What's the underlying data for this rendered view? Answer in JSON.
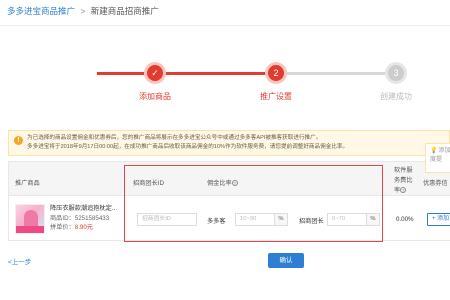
{
  "breadcrumb": {
    "root": "多多进宝商品推广",
    "separator": ">",
    "current": "新建商品招商推广"
  },
  "steps": [
    {
      "label": "添加商品",
      "state": "done",
      "icon": "check-icon"
    },
    {
      "label": "推广设置",
      "state": "active",
      "number": "2"
    },
    {
      "label": "创建成功",
      "state": "todo",
      "number": "3"
    }
  ],
  "notice": {
    "icon": "warning-icon",
    "line1": "为已选择的商品设置佣金和优惠券后，您的推广商品将展示在多多进宝公众号中或通过多多客API被推客获取进行推广。",
    "line2": "多多进宝将于2018年9月17日00:00起，在成功推广商品后收取该商品佣金的10%作为软件服务费，请您提前调整好商品佣金比率。"
  },
  "tooltip": {
    "icon": "lightbulb-icon",
    "line1": "添加",
    "line2": "度提"
  },
  "table": {
    "headers": {
      "product": "推广商品",
      "group_id": "招商团长ID",
      "rate": "佣金比率",
      "service_fee": "软件服务费比率",
      "coupon": "优惠券信"
    },
    "row": {
      "name": "降压衣服款潮追抱枕定...",
      "id_label": "商品ID：",
      "id": "5251585433",
      "price_label": "拼单价：",
      "price": "8.90元",
      "group_placeholder": "招商团长ID",
      "rate_label_1": "多多客",
      "rate_placeholder_1": "10~90",
      "pct": "%",
      "rate_label_2": "招商团长",
      "rate_placeholder_2": "0~70",
      "service_fee": "0.00%",
      "add_coupon": "+ 添加"
    }
  },
  "footer": {
    "back": "<上一步",
    "confirm": "确认"
  },
  "colors": {
    "accent_red": "#e23b2f",
    "link_blue": "#2e7fd4",
    "highlight_red": "#e8434b"
  }
}
